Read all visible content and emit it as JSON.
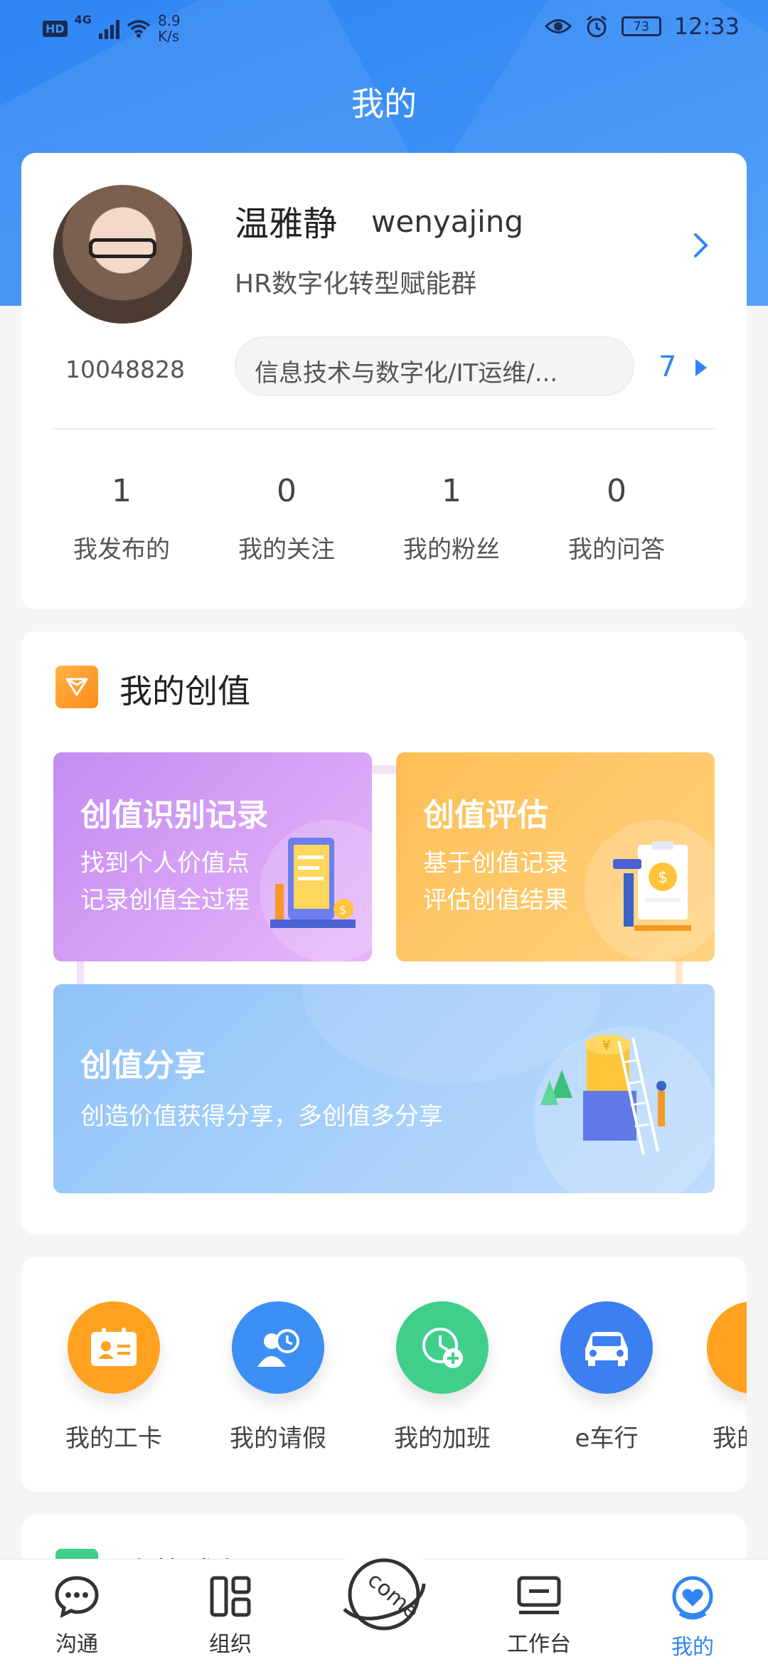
{
  "status_bar": {
    "network_badge": "HD",
    "network_type": "4G",
    "speed_value": "8.9",
    "speed_unit": "K/s",
    "battery": "73",
    "time": "12:33"
  },
  "header": {
    "title": "我的"
  },
  "profile": {
    "name": "温雅静",
    "username": "wenyajing",
    "group": "HR数字化转型赋能群",
    "employee_id": "10048828",
    "department": "信息技术与数字化/IT运维/...",
    "department_count": "7",
    "stats": [
      {
        "value": "1",
        "label": "我发布的"
      },
      {
        "value": "0",
        "label": "我的关注"
      },
      {
        "value": "1",
        "label": "我的粉丝"
      },
      {
        "value": "0",
        "label": "我的问答"
      }
    ]
  },
  "creation": {
    "title": "我的创值",
    "tiles": [
      {
        "title": "创值识别记录",
        "line1": "找到个人价值点",
        "line2": "记录创值全过程"
      },
      {
        "title": "创值评估",
        "line1": "基于创值记录",
        "line2": "评估创值结果"
      },
      {
        "title": "创值分享",
        "line1": "创造价值获得分享，多创值多分享"
      }
    ]
  },
  "tools": [
    {
      "label": "我的工卡",
      "icon": "id-card-icon",
      "color": "#ffa21f"
    },
    {
      "label": "我的请假",
      "icon": "leave-clock-icon",
      "color": "#3c8ff5"
    },
    {
      "label": "我的加班",
      "icon": "overtime-clock-icon",
      "color": "#3fcf8a"
    },
    {
      "label": "e车行",
      "icon": "car-icon",
      "color": "#3c7ff0"
    },
    {
      "label": "我的",
      "icon": "partial-icon",
      "color": "#ffa21f"
    }
  ],
  "next_section": {
    "title": "我的成长"
  },
  "tabbar": {
    "tabs": [
      {
        "label": "沟通",
        "icon": "chat-icon"
      },
      {
        "label": "组织",
        "icon": "org-icon"
      },
      {
        "label": "come",
        "icon": "come-logo-icon"
      },
      {
        "label": "工作台",
        "icon": "workbench-icon"
      },
      {
        "label": "我的",
        "icon": "profile-heart-icon",
        "active": true
      }
    ],
    "accent": "#2f86f3"
  }
}
